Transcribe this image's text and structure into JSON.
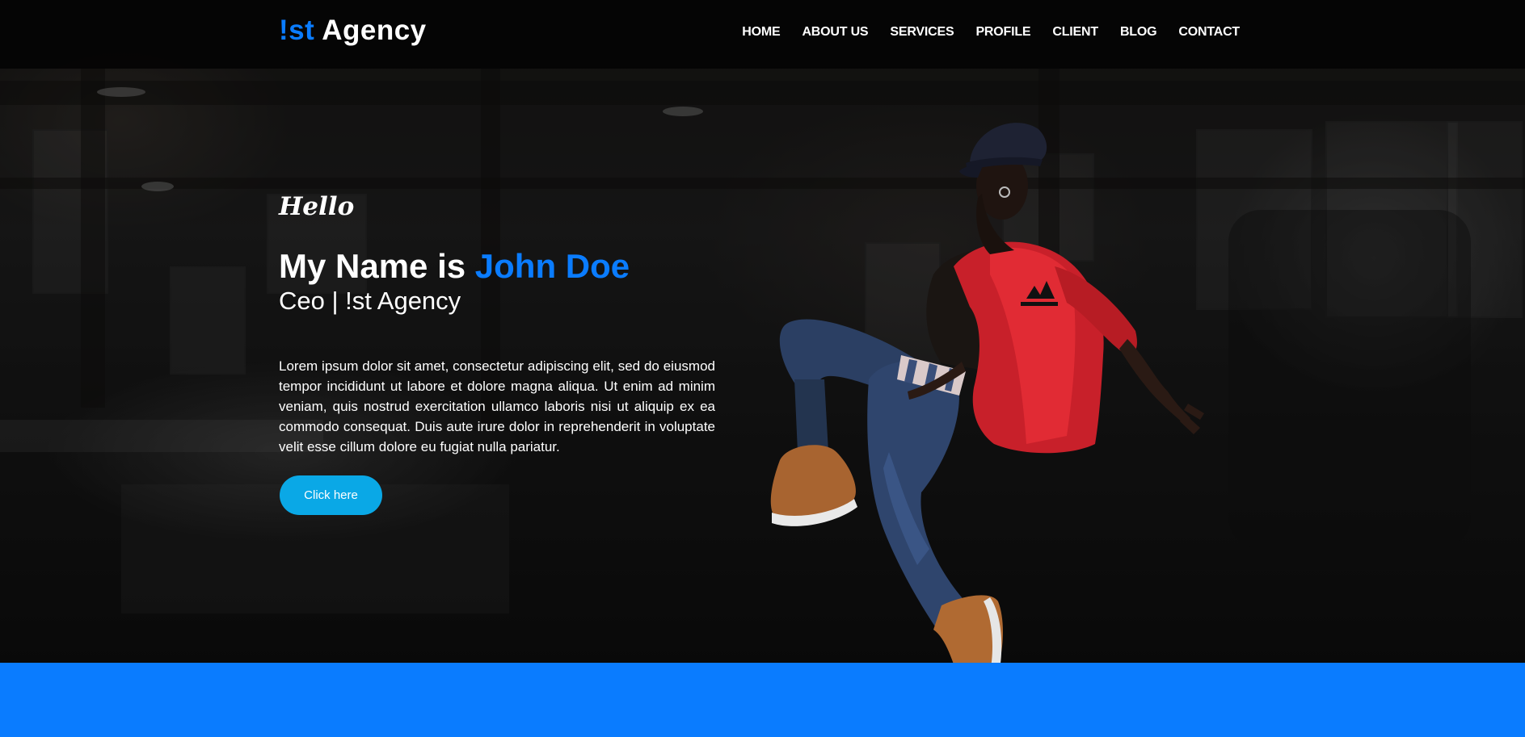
{
  "header": {
    "logo_accent": "!st",
    "logo_rest": " Agency",
    "nav": [
      {
        "label": "HOME"
      },
      {
        "label": "ABOUT US"
      },
      {
        "label": "SERVICES"
      },
      {
        "label": "PROFILE"
      },
      {
        "label": "CLIENT"
      },
      {
        "label": "BLOG"
      },
      {
        "label": "CONTACT"
      }
    ]
  },
  "hero": {
    "greeting": "Hello",
    "name_prefix": "My Name is ",
    "name": "John Doe",
    "subtitle": "Ceo | !st Agency",
    "description": "Lorem ipsum dolor sit amet, consectetur adipiscing elit, sed do eiusmod tempor incididunt ut labore et dolore magna aliqua. Ut enim ad minim veniam, quis nostrud exercitation ullamco laboris nisi ut aliquip ex ea commodo consequat. Duis aute irure dolor in reprehenderit in voluptate velit esse cillum dolore eu fugiat nulla pariatur.",
    "cta_label": "Click here"
  },
  "colors": {
    "accent": "#0a7cff",
    "button": "#0aa8e6",
    "header_bg": "#050505"
  }
}
